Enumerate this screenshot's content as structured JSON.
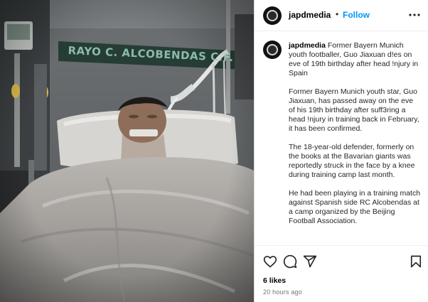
{
  "post": {
    "banner_text": "RAYO C. ALCOBENDAS C.F.",
    "username": "japdmedia",
    "follow_label": "Follow",
    "separator": "•",
    "caption": {
      "username": "japdmedia",
      "headline": "Former Bayern Munich youth footballer, Guo Jiaxuan d!es on eve of 19th birthday after head !njury in Spain",
      "paragraphs": [
        "Former Bayern Munich youth star, Guo Jiaxuan, has passed away on the eve of his 19th birthday after suff3ring a head !njury in training back in February, it has been confirmed.",
        "The 18-year-old defender, formerly on the books at the Bavarian giants was reportedly struck in the face by a knee during training camp last month.",
        "He had been playing in a training match against Spanish side RC Alcobendas at a camp organized by the Beijing Football Association."
      ]
    },
    "likes": "6 likes",
    "time": "20 hours ago"
  },
  "icons": {
    "more": "more-options-icon",
    "like": "heart-icon",
    "comment": "comment-icon",
    "share": "share-icon",
    "save": "bookmark-icon"
  },
  "colors": {
    "follow": "#0095f6",
    "text": "#262626",
    "muted": "#737373",
    "banner": "#9fd2c0"
  }
}
